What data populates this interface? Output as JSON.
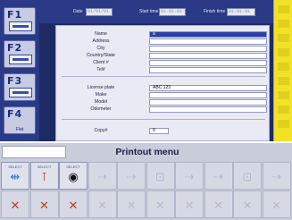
{
  "function_keys": [
    {
      "label": "F1",
      "text": ""
    },
    {
      "label": "F2",
      "text": ""
    },
    {
      "label": "F3",
      "text": ""
    },
    {
      "label": "F4",
      "text": "Flat"
    }
  ],
  "header": {
    "date_label": "Date",
    "date_value": "01/01/01",
    "start_time_label": "Start time",
    "start_time_value": "01.01.01",
    "finish_time_label": "Finish time",
    "finish_time_value": "01.01.01"
  },
  "form": {
    "rows": [
      {
        "label": "Name",
        "value": "a",
        "active": true
      },
      {
        "label": "Address",
        "value": ""
      },
      {
        "label": "City",
        "value": ""
      },
      {
        "label": "Country/State",
        "value": ""
      },
      {
        "label": "Client #",
        "value": ""
      },
      {
        "label": "Tel#",
        "value": ""
      },
      {
        "label": "License plate",
        "value": "ABC 123"
      },
      {
        "label": "Make",
        "value": ""
      },
      {
        "label": "Model",
        "value": ""
      },
      {
        "label": "Odometer",
        "value": ""
      }
    ],
    "copy_label": "Copy#",
    "copy_value": "0"
  },
  "menu": {
    "title": "Printout menu"
  },
  "tiles_row1": [
    {
      "name": "alignment-print-tile",
      "caption": "SELECT",
      "glyph": "⇹",
      "icon": "alignment-icon",
      "state": "on",
      "color": "#2c6fd6"
    },
    {
      "name": "single-wheel-print-tile",
      "caption": "SELECT",
      "glyph": "⊺",
      "icon": "wheel-icon",
      "state": "on",
      "color": "#c0392b"
    },
    {
      "name": "tire-print-tile",
      "caption": "SELECT",
      "glyph": "◉",
      "icon": "tire-icon",
      "state": "on",
      "color": "#111111"
    },
    {
      "name": "disabled-tile-4",
      "caption": "",
      "glyph": "⇢",
      "icon": "arrow-icon",
      "state": "dim"
    },
    {
      "name": "disabled-tile-5",
      "caption": "",
      "glyph": "⇢",
      "icon": "arrow-icon",
      "state": "dim"
    },
    {
      "name": "disabled-tile-6",
      "caption": "",
      "glyph": "⊡",
      "icon": "box-icon",
      "state": "dim"
    },
    {
      "name": "disabled-tile-7",
      "caption": "",
      "glyph": "⇢",
      "icon": "arrow-icon",
      "state": "dim"
    },
    {
      "name": "disabled-tile-8",
      "caption": "",
      "glyph": "⇢",
      "icon": "arrow-icon",
      "state": "dim"
    },
    {
      "name": "disabled-tile-9",
      "caption": "",
      "glyph": "⊡",
      "icon": "box-icon",
      "state": "dim"
    },
    {
      "name": "disabled-tile-10",
      "caption": "",
      "glyph": "⇢",
      "icon": "arrow-icon",
      "state": "dim"
    }
  ],
  "tiles_row2": [
    {
      "name": "cancel-tile-1",
      "glyph": "✕",
      "icon": "cancel-icon",
      "state": "red"
    },
    {
      "name": "cancel-tile-2",
      "glyph": "✕",
      "icon": "cancel-icon",
      "state": "red"
    },
    {
      "name": "cancel-tile-3",
      "glyph": "✕",
      "icon": "cancel-icon",
      "state": "red"
    },
    {
      "name": "disabled-tile-11",
      "glyph": "✕",
      "icon": "cancel-icon",
      "state": "dim"
    },
    {
      "name": "disabled-tile-12",
      "glyph": "✕",
      "icon": "cancel-icon",
      "state": "dim"
    },
    {
      "name": "disabled-tile-13",
      "glyph": "✕",
      "icon": "cancel-icon",
      "state": "dim"
    },
    {
      "name": "disabled-tile-14",
      "glyph": "✕",
      "icon": "cancel-icon",
      "state": "dim"
    },
    {
      "name": "disabled-tile-15",
      "glyph": "✕",
      "icon": "cancel-icon",
      "state": "dim"
    },
    {
      "name": "disabled-tile-16",
      "glyph": "✕",
      "icon": "cancel-icon",
      "state": "dim"
    },
    {
      "name": "disabled-tile-17",
      "glyph": "✕",
      "icon": "cancel-icon",
      "state": "dim"
    }
  ],
  "colors": {
    "background": "#1e2a63",
    "panel": "#e9eaf3",
    "accent": "#2c3fa5",
    "strip": "#f1e227",
    "danger": "#c0392b"
  }
}
